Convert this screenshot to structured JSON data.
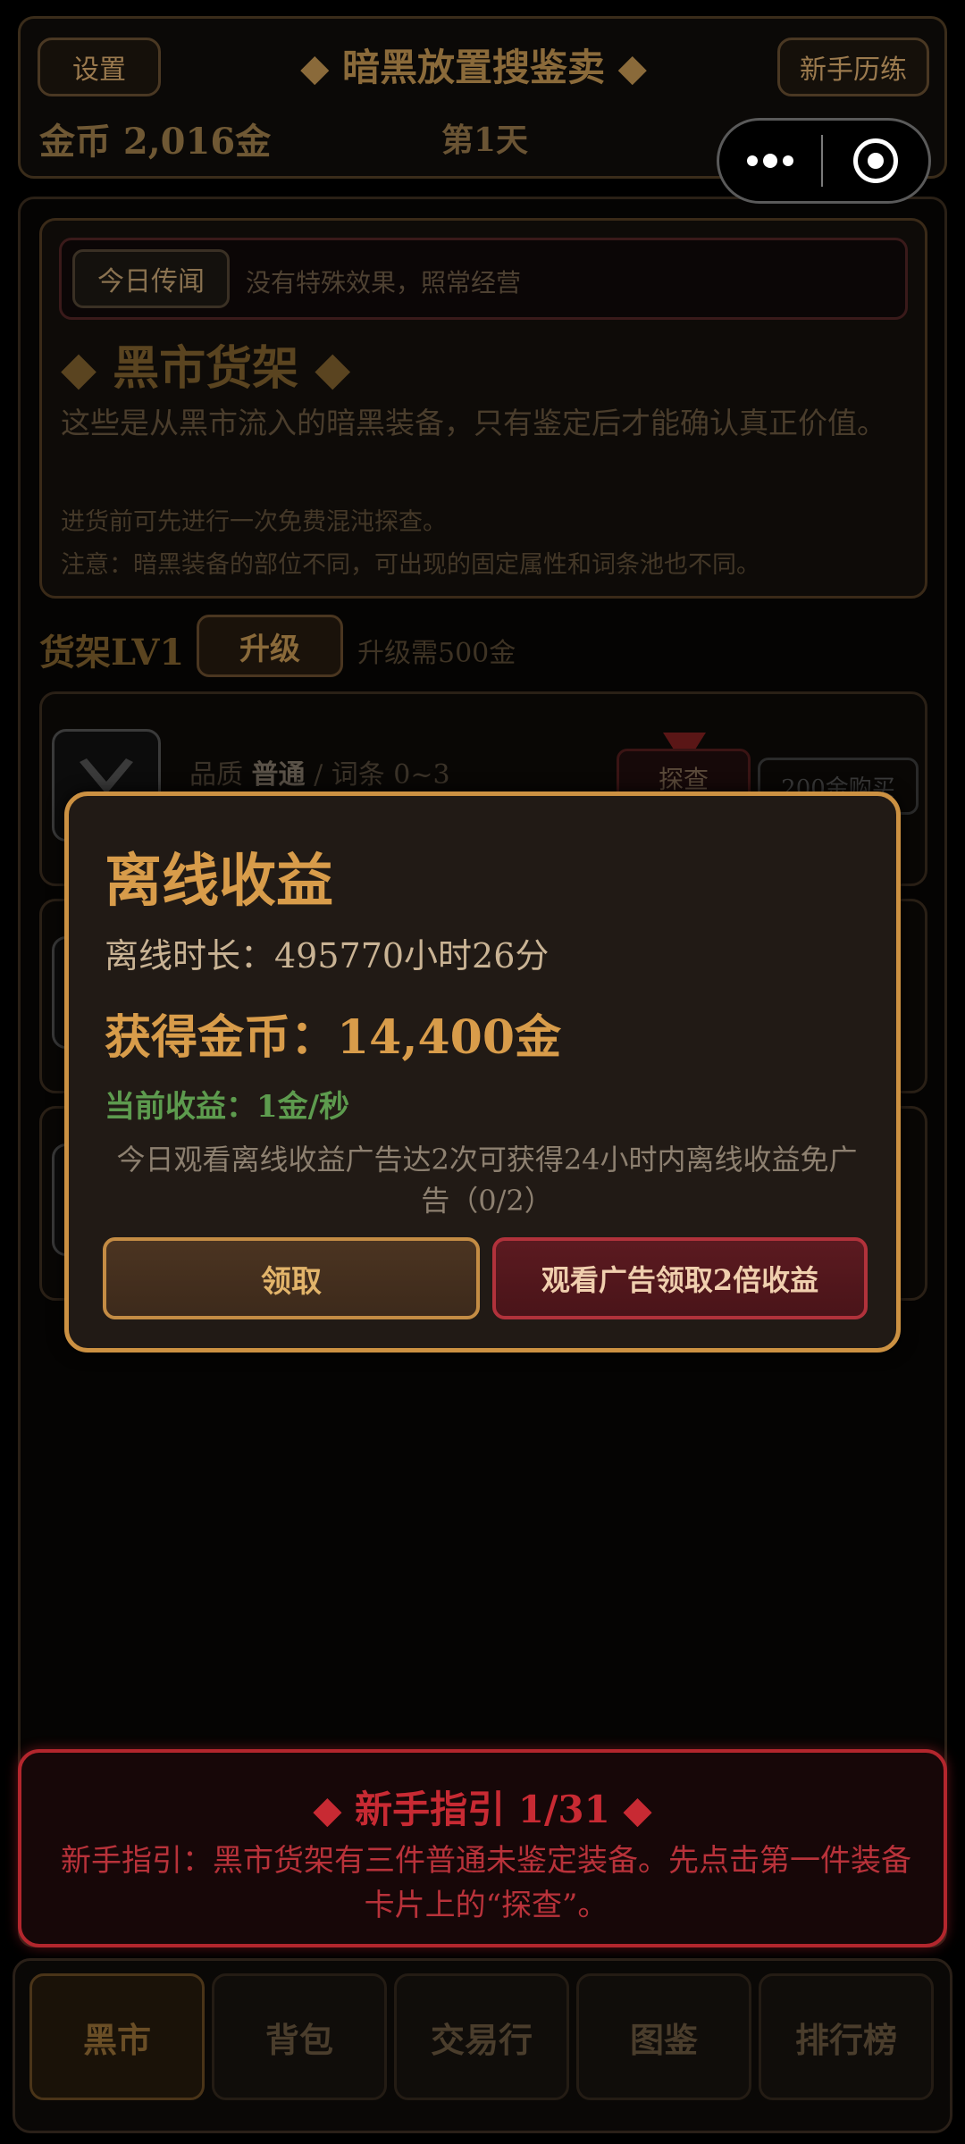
{
  "header": {
    "settings_label": "设置",
    "title": "◆ 暗黑放置搜鉴卖 ◆",
    "newbie_label": "新手历练",
    "gold": "金币 2,016金",
    "day": "第1天"
  },
  "news": {
    "tag": "今日传闻",
    "text": "没有特殊效果，照常经营"
  },
  "shelf": {
    "title": "◆ 黑市货架 ◆",
    "desc": "这些是从黑市流入的暗黑装备，只有鉴定后才能确认真正价值。",
    "note1": "进货前可先进行一次免费混沌探查。",
    "note2": "注意：暗黑装备的部位不同，可出现的固定属性和词条池也不同。",
    "level": "货架LV1",
    "upgrade_label": "升级",
    "upgrade_need": "升级需500金"
  },
  "card": {
    "quality_prefix": "品质 ",
    "quality": "普通",
    "affix": " / 词条 0~3",
    "probe_label": "探查",
    "price_label": "200金购买"
  },
  "modal": {
    "title": "离线收益",
    "duration": "离线时长：495770小时26分",
    "gain": "获得金币：14,400金",
    "rate": "当前收益：1金/秒",
    "tip": "今日观看离线收益广告达2次可获得24小时内离线收益免广告（0/2）",
    "claim_label": "领取",
    "ad_label": "观看广告领取2倍收益"
  },
  "guide": {
    "title": "◆ 新手指引 1/31 ◆",
    "text": "新手指引：黑市货架有三件普通未鉴定装备。先点击第一件装备卡片上的“探查”。"
  },
  "tabs": [
    {
      "label": "黑市"
    },
    {
      "label": "背包"
    },
    {
      "label": "交易行"
    },
    {
      "label": "图鉴"
    },
    {
      "label": "排行榜"
    }
  ],
  "colors": {
    "modal_border": "#cc9142",
    "gold_text": "#d89c4a",
    "rate_green": "#5d9b4e",
    "guide_red": "#c82a33"
  },
  "icons": {
    "capsule_more": "more-dots-icon",
    "capsule_close": "target-circle-icon"
  }
}
